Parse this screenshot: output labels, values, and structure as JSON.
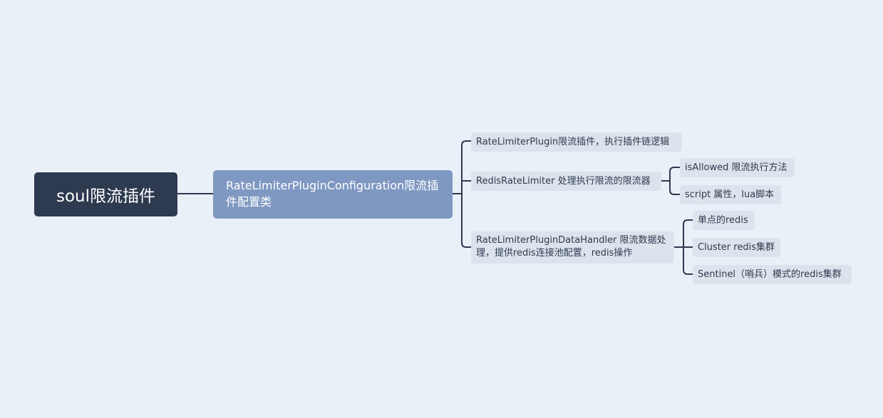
{
  "mindmap": {
    "root": {
      "label": "soul限流插件"
    },
    "main": {
      "label": "RateLimiterPluginConfiguration限流插件配置类"
    },
    "branches": {
      "plugin": {
        "label": "RateLimiterPlugin限流插件，执行插件链逻辑"
      },
      "redis_limiter": {
        "label": "RedisRateLimiter 处理执行限流的限流器",
        "children": [
          {
            "label": "isAllowed 限流执行方法"
          },
          {
            "label": "script 属性，lua脚本"
          }
        ]
      },
      "data_handler": {
        "label": "RateLimiterPluginDataHandler 限流数据处理，提供redis连接池配置，redis操作",
        "children": [
          {
            "label": "单点的redis"
          },
          {
            "label": "Cluster redis集群"
          },
          {
            "label": "Sentinel（哨兵）模式的redis集群"
          }
        ]
      }
    },
    "colors": {
      "background": "#e9f0f8",
      "root": "#2e3a4f",
      "main": "#7f98c2",
      "leaf": "#dce3ec",
      "connector": "#2e3a4f"
    }
  }
}
